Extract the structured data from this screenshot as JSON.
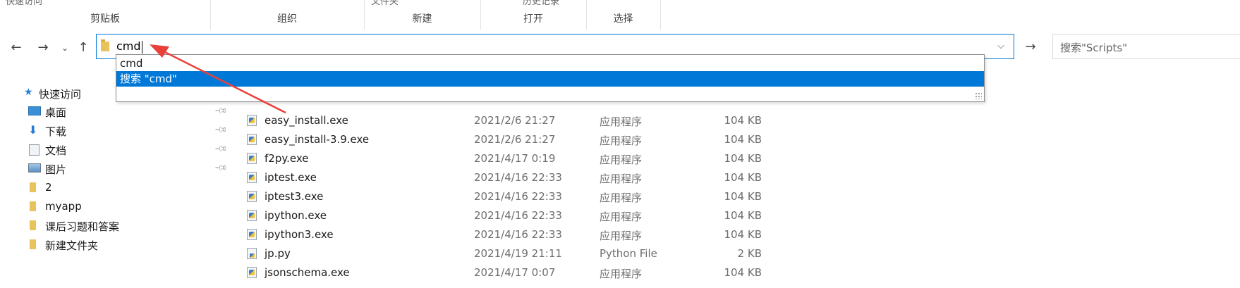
{
  "ribbon": {
    "cut_left": "快速访问",
    "cut_mid": "文件夹",
    "cut_right": "历史记录",
    "groups": [
      "剪贴板",
      "组织",
      "新建",
      "打开",
      "选择"
    ]
  },
  "address": {
    "value": "cmd",
    "dropdown_icon": "chevron-down",
    "go_icon": "arrow-right"
  },
  "search": {
    "placeholder": "搜索\"Scripts\""
  },
  "autocomplete": {
    "items": [
      {
        "label": "cmd",
        "selected": false
      },
      {
        "label": "搜索 \"cmd\"",
        "selected": true
      }
    ]
  },
  "nav": {
    "items": [
      {
        "label": "快速访问",
        "icon": "star-icon"
      },
      {
        "label": "桌面",
        "icon": "desktop-icon",
        "pinned": true
      },
      {
        "label": "下载",
        "icon": "download-icon",
        "pinned": true
      },
      {
        "label": "文档",
        "icon": "document-icon",
        "pinned": true
      },
      {
        "label": "图片",
        "icon": "picture-icon",
        "pinned": true
      },
      {
        "label": "2",
        "icon": "folder-icon"
      },
      {
        "label": "myapp",
        "icon": "folder-icon"
      },
      {
        "label": "课后习题和答案",
        "icon": "folder-icon"
      },
      {
        "label": "新建文件夹",
        "icon": "folder-icon"
      }
    ]
  },
  "files": [
    {
      "name": "easy_install.exe",
      "date": "2021/2/6 21:27",
      "type": "应用程序",
      "size": "104 KB",
      "kind": "exe"
    },
    {
      "name": "easy_install-3.9.exe",
      "date": "2021/2/6 21:27",
      "type": "应用程序",
      "size": "104 KB",
      "kind": "exe"
    },
    {
      "name": "f2py.exe",
      "date": "2021/4/17 0:19",
      "type": "应用程序",
      "size": "104 KB",
      "kind": "exe"
    },
    {
      "name": "iptest.exe",
      "date": "2021/4/16 22:33",
      "type": "应用程序",
      "size": "104 KB",
      "kind": "exe"
    },
    {
      "name": "iptest3.exe",
      "date": "2021/4/16 22:33",
      "type": "应用程序",
      "size": "104 KB",
      "kind": "exe"
    },
    {
      "name": "ipython.exe",
      "date": "2021/4/16 22:33",
      "type": "应用程序",
      "size": "104 KB",
      "kind": "exe"
    },
    {
      "name": "ipython3.exe",
      "date": "2021/4/16 22:33",
      "type": "应用程序",
      "size": "104 KB",
      "kind": "exe"
    },
    {
      "name": "jp.py",
      "date": "2021/4/19 21:11",
      "type": "Python File",
      "size": "2 KB",
      "kind": "py"
    },
    {
      "name": "jsonschema.exe",
      "date": "2021/4/17 0:07",
      "type": "应用程序",
      "size": "104 KB",
      "kind": "exe"
    }
  ],
  "colors": {
    "accent": "#0078d7",
    "annotation": "#e8413c"
  }
}
